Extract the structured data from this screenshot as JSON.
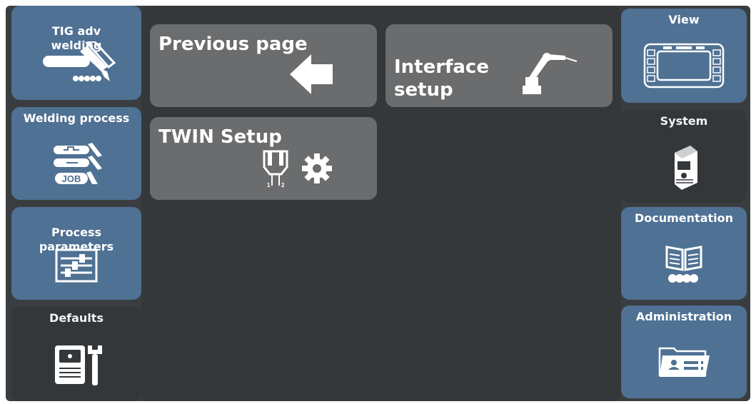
{
  "left_nav": {
    "items": [
      {
        "label": "TIG adv\nwelding",
        "icon": "tig-torch-icon",
        "style": "blue"
      },
      {
        "label": "Welding process",
        "icon": "welding-process-job-icon",
        "style": "blue"
      },
      {
        "label": "Process\nparameters",
        "icon": "sliders-icon",
        "style": "blue"
      },
      {
        "label": "Defaults",
        "icon": "power-source-wrench-icon",
        "style": "dark"
      }
    ]
  },
  "right_nav": {
    "items": [
      {
        "label": "View",
        "icon": "display-icon",
        "style": "blue"
      },
      {
        "label": "System",
        "icon": "power-source-icon",
        "style": "dark"
      },
      {
        "label": "Documentation",
        "icon": "book-icon",
        "style": "blue"
      },
      {
        "label": "Administration",
        "icon": "id-card-folder-icon",
        "style": "blue"
      }
    ]
  },
  "main": {
    "buttons": [
      {
        "label": "Previous page",
        "icon": "arrow-left-icon"
      },
      {
        "label": "Interface\nsetup",
        "icon": "robot-arm-icon"
      },
      {
        "label": "TWIN Setup",
        "icon": "twin-gear-icon"
      }
    ]
  },
  "colors": {
    "blue_tile": "#4f7193",
    "button_gray": "#6a6c6e",
    "background": "#3a3d40"
  }
}
